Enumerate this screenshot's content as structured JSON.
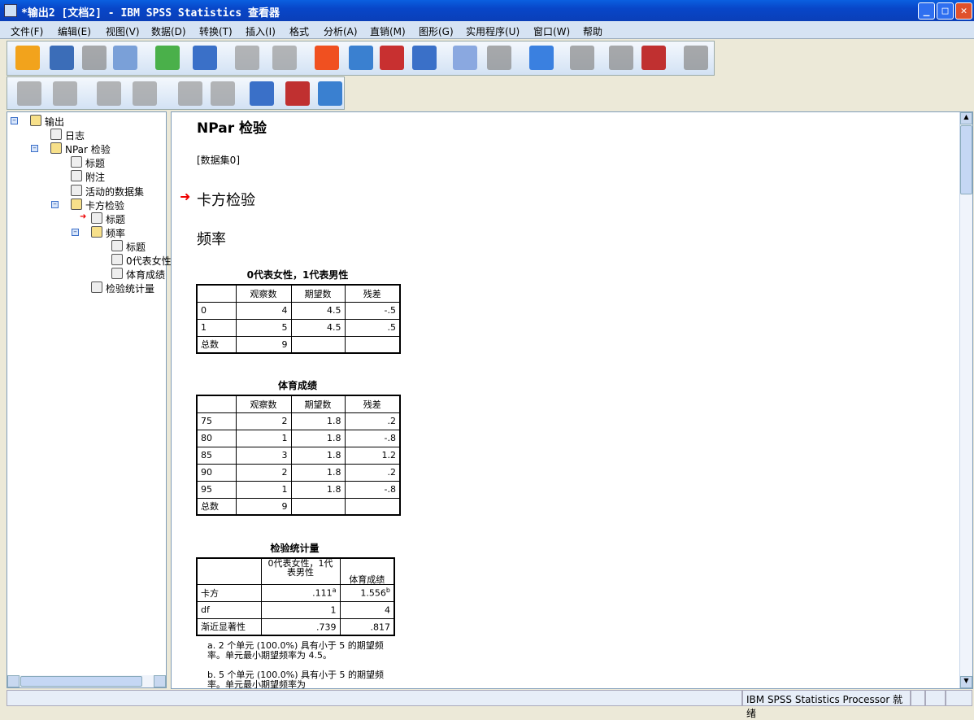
{
  "window": {
    "title": "*输出2 [文档2] - IBM SPSS Statistics 查看器"
  },
  "menu": [
    "文件(F)",
    "编辑(E)",
    "视图(V)",
    "数据(D)",
    "转换(T)",
    "插入(I)",
    "格式",
    "分析(A)",
    "直销(M)",
    "图形(G)",
    "实用程序(U)",
    "窗口(W)",
    "帮助"
  ],
  "toolbar1": [
    "open-icon",
    "save-icon",
    "print-icon",
    "print-preview-icon",
    "export-icon",
    "recall-dialog-icon",
    "undo-icon",
    "redo-icon",
    "goto-case-icon",
    "goto-variable-icon",
    "insert-case-icon",
    "variables-icon",
    "use-sets-icon",
    "show-all-variables-icon",
    "designate-window-icon",
    "promote-icon",
    "edit-icon",
    "run-script-icon",
    "output-icon"
  ],
  "toolbar2": [
    "back-icon",
    "forward-icon",
    "expand-icon",
    "collapse-icon",
    "show-icon",
    "hide-icon",
    "insert-heading-icon",
    "insert-title-icon",
    "insert-text-icon"
  ],
  "outline": [
    {
      "label": "输出",
      "level": 0
    },
    {
      "label": "日志",
      "level": 1
    },
    {
      "label": "NPar 检验",
      "level": 1
    },
    {
      "label": "标题",
      "level": 2
    },
    {
      "label": "附注",
      "level": 2
    },
    {
      "label": "活动的数据集",
      "level": 2
    },
    {
      "label": "卡方检验",
      "level": 2
    },
    {
      "label": "标题",
      "level": 3
    },
    {
      "label": "频率",
      "level": 3
    },
    {
      "label": "标题",
      "level": 4
    },
    {
      "label": "0代表女性",
      "level": 4
    },
    {
      "label": "体育成绩",
      "level": 4
    },
    {
      "label": "检验统计量",
      "level": 3
    }
  ],
  "content": {
    "heading": "NPar 检验",
    "dataset": "[数据集0]",
    "section": "卡方检验",
    "subsection": "频率",
    "table1": {
      "title": "0代表女性，1代表男性",
      "headers": [
        "",
        "观察数",
        "期望数",
        "残差"
      ],
      "rows": [
        [
          "0",
          "4",
          "4.5",
          "-.5"
        ],
        [
          "1",
          "5",
          "4.5",
          ".5"
        ],
        [
          "总数",
          "9",
          "",
          ""
        ]
      ]
    },
    "table2": {
      "title": "体育成绩",
      "headers": [
        "",
        "观察数",
        "期望数",
        "残差"
      ],
      "rows": [
        [
          "75",
          "2",
          "1.8",
          ".2"
        ],
        [
          "80",
          "1",
          "1.8",
          "-.8"
        ],
        [
          "85",
          "3",
          "1.8",
          "1.2"
        ],
        [
          "90",
          "2",
          "1.8",
          ".2"
        ],
        [
          "95",
          "1",
          "1.8",
          "-.8"
        ],
        [
          "总数",
          "9",
          "",
          ""
        ]
      ]
    },
    "table3": {
      "title": "检验统计量",
      "headers": [
        "",
        "0代表女性，1代表男性",
        "体育成绩"
      ],
      "rows": [
        [
          "卡方",
          ".111",
          "a",
          "1.556",
          "b"
        ],
        [
          "df",
          "1",
          "",
          "4",
          ""
        ],
        [
          "渐近显著性",
          ".739",
          "",
          ".817",
          ""
        ]
      ],
      "footnotes": [
        "a. 2 个单元 (100.0%) 具有小于 5 的期望频率。单元最小期望频率为 4.5。",
        "b. 5 个单元 (100.0%) 具有小于 5 的期望频率。单元最小期望频率为"
      ]
    }
  },
  "status": {
    "processor": "IBM SPSS Statistics Processor 就绪"
  }
}
